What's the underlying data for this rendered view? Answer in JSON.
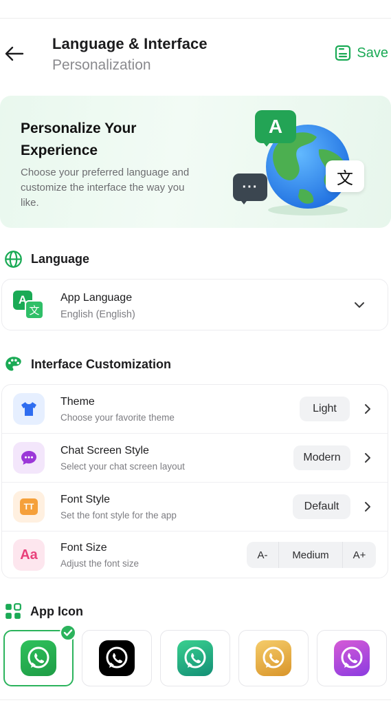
{
  "header": {
    "title": "Language & Interface",
    "subtitle": "Personalization",
    "save_label": "Save"
  },
  "hero": {
    "title_line1": "Personalize Your",
    "title_line2": "Experience",
    "description": "Choose your preferred language and customize the interface the way you like.",
    "bubble_letter": "A",
    "bubble_glyph": "文",
    "bubble_dots": "···"
  },
  "language": {
    "section_title": "Language",
    "app_language_title": "App Language",
    "app_language_value": "English (English)",
    "icon_glyph_a": "A",
    "icon_glyph_b": "文"
  },
  "interface": {
    "section_title": "Interface Customization",
    "rows": [
      {
        "title": "Theme",
        "subtitle": "Choose your favorite theme",
        "value": "Light",
        "icon": "tshirt-icon"
      },
      {
        "title": "Chat Screen Style",
        "subtitle": "Select your chat screen layout",
        "value": "Modern",
        "icon": "chat-bubble-icon"
      },
      {
        "title": "Font Style",
        "subtitle": "Set the font style for the app",
        "value": "Default",
        "icon": "font-style-icon"
      },
      {
        "title": "Font Size",
        "subtitle": "Adjust the font size",
        "value": "Medium",
        "icon": "font-size-icon"
      }
    ],
    "font_size_decrease": "A-",
    "font_size_increase": "A+",
    "font_style_glyph": "TT",
    "font_size_glyph": "Aa"
  },
  "app_icon": {
    "section_title": "App Icon",
    "selected_index": 0,
    "options": [
      {
        "name": "green",
        "bg": "#25a244"
      },
      {
        "name": "black",
        "bg": "#000000"
      },
      {
        "name": "teal",
        "bg": "#1fa57a"
      },
      {
        "name": "gold",
        "bg": "#e6a93a"
      },
      {
        "name": "purple",
        "bg": "#b04ad6"
      }
    ]
  },
  "colors": {
    "accent": "#1aaa55",
    "selected_border": "#2bb35c"
  }
}
